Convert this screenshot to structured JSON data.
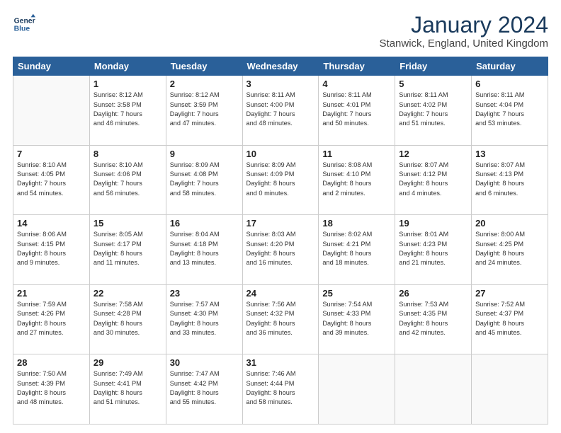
{
  "header": {
    "logo_line1": "General",
    "logo_line2": "Blue",
    "title": "January 2024",
    "location": "Stanwick, England, United Kingdom"
  },
  "days_of_week": [
    "Sunday",
    "Monday",
    "Tuesday",
    "Wednesday",
    "Thursday",
    "Friday",
    "Saturday"
  ],
  "weeks": [
    [
      {
        "day": "",
        "info": ""
      },
      {
        "day": "1",
        "info": "Sunrise: 8:12 AM\nSunset: 3:58 PM\nDaylight: 7 hours\nand 46 minutes."
      },
      {
        "day": "2",
        "info": "Sunrise: 8:12 AM\nSunset: 3:59 PM\nDaylight: 7 hours\nand 47 minutes."
      },
      {
        "day": "3",
        "info": "Sunrise: 8:11 AM\nSunset: 4:00 PM\nDaylight: 7 hours\nand 48 minutes."
      },
      {
        "day": "4",
        "info": "Sunrise: 8:11 AM\nSunset: 4:01 PM\nDaylight: 7 hours\nand 50 minutes."
      },
      {
        "day": "5",
        "info": "Sunrise: 8:11 AM\nSunset: 4:02 PM\nDaylight: 7 hours\nand 51 minutes."
      },
      {
        "day": "6",
        "info": "Sunrise: 8:11 AM\nSunset: 4:04 PM\nDaylight: 7 hours\nand 53 minutes."
      }
    ],
    [
      {
        "day": "7",
        "info": "Sunrise: 8:10 AM\nSunset: 4:05 PM\nDaylight: 7 hours\nand 54 minutes."
      },
      {
        "day": "8",
        "info": "Sunrise: 8:10 AM\nSunset: 4:06 PM\nDaylight: 7 hours\nand 56 minutes."
      },
      {
        "day": "9",
        "info": "Sunrise: 8:09 AM\nSunset: 4:08 PM\nDaylight: 7 hours\nand 58 minutes."
      },
      {
        "day": "10",
        "info": "Sunrise: 8:09 AM\nSunset: 4:09 PM\nDaylight: 8 hours\nand 0 minutes."
      },
      {
        "day": "11",
        "info": "Sunrise: 8:08 AM\nSunset: 4:10 PM\nDaylight: 8 hours\nand 2 minutes."
      },
      {
        "day": "12",
        "info": "Sunrise: 8:07 AM\nSunset: 4:12 PM\nDaylight: 8 hours\nand 4 minutes."
      },
      {
        "day": "13",
        "info": "Sunrise: 8:07 AM\nSunset: 4:13 PM\nDaylight: 8 hours\nand 6 minutes."
      }
    ],
    [
      {
        "day": "14",
        "info": "Sunrise: 8:06 AM\nSunset: 4:15 PM\nDaylight: 8 hours\nand 9 minutes."
      },
      {
        "day": "15",
        "info": "Sunrise: 8:05 AM\nSunset: 4:17 PM\nDaylight: 8 hours\nand 11 minutes."
      },
      {
        "day": "16",
        "info": "Sunrise: 8:04 AM\nSunset: 4:18 PM\nDaylight: 8 hours\nand 13 minutes."
      },
      {
        "day": "17",
        "info": "Sunrise: 8:03 AM\nSunset: 4:20 PM\nDaylight: 8 hours\nand 16 minutes."
      },
      {
        "day": "18",
        "info": "Sunrise: 8:02 AM\nSunset: 4:21 PM\nDaylight: 8 hours\nand 18 minutes."
      },
      {
        "day": "19",
        "info": "Sunrise: 8:01 AM\nSunset: 4:23 PM\nDaylight: 8 hours\nand 21 minutes."
      },
      {
        "day": "20",
        "info": "Sunrise: 8:00 AM\nSunset: 4:25 PM\nDaylight: 8 hours\nand 24 minutes."
      }
    ],
    [
      {
        "day": "21",
        "info": "Sunrise: 7:59 AM\nSunset: 4:26 PM\nDaylight: 8 hours\nand 27 minutes."
      },
      {
        "day": "22",
        "info": "Sunrise: 7:58 AM\nSunset: 4:28 PM\nDaylight: 8 hours\nand 30 minutes."
      },
      {
        "day": "23",
        "info": "Sunrise: 7:57 AM\nSunset: 4:30 PM\nDaylight: 8 hours\nand 33 minutes."
      },
      {
        "day": "24",
        "info": "Sunrise: 7:56 AM\nSunset: 4:32 PM\nDaylight: 8 hours\nand 36 minutes."
      },
      {
        "day": "25",
        "info": "Sunrise: 7:54 AM\nSunset: 4:33 PM\nDaylight: 8 hours\nand 39 minutes."
      },
      {
        "day": "26",
        "info": "Sunrise: 7:53 AM\nSunset: 4:35 PM\nDaylight: 8 hours\nand 42 minutes."
      },
      {
        "day": "27",
        "info": "Sunrise: 7:52 AM\nSunset: 4:37 PM\nDaylight: 8 hours\nand 45 minutes."
      }
    ],
    [
      {
        "day": "28",
        "info": "Sunrise: 7:50 AM\nSunset: 4:39 PM\nDaylight: 8 hours\nand 48 minutes."
      },
      {
        "day": "29",
        "info": "Sunrise: 7:49 AM\nSunset: 4:41 PM\nDaylight: 8 hours\nand 51 minutes."
      },
      {
        "day": "30",
        "info": "Sunrise: 7:47 AM\nSunset: 4:42 PM\nDaylight: 8 hours\nand 55 minutes."
      },
      {
        "day": "31",
        "info": "Sunrise: 7:46 AM\nSunset: 4:44 PM\nDaylight: 8 hours\nand 58 minutes."
      },
      {
        "day": "",
        "info": ""
      },
      {
        "day": "",
        "info": ""
      },
      {
        "day": "",
        "info": ""
      }
    ]
  ]
}
